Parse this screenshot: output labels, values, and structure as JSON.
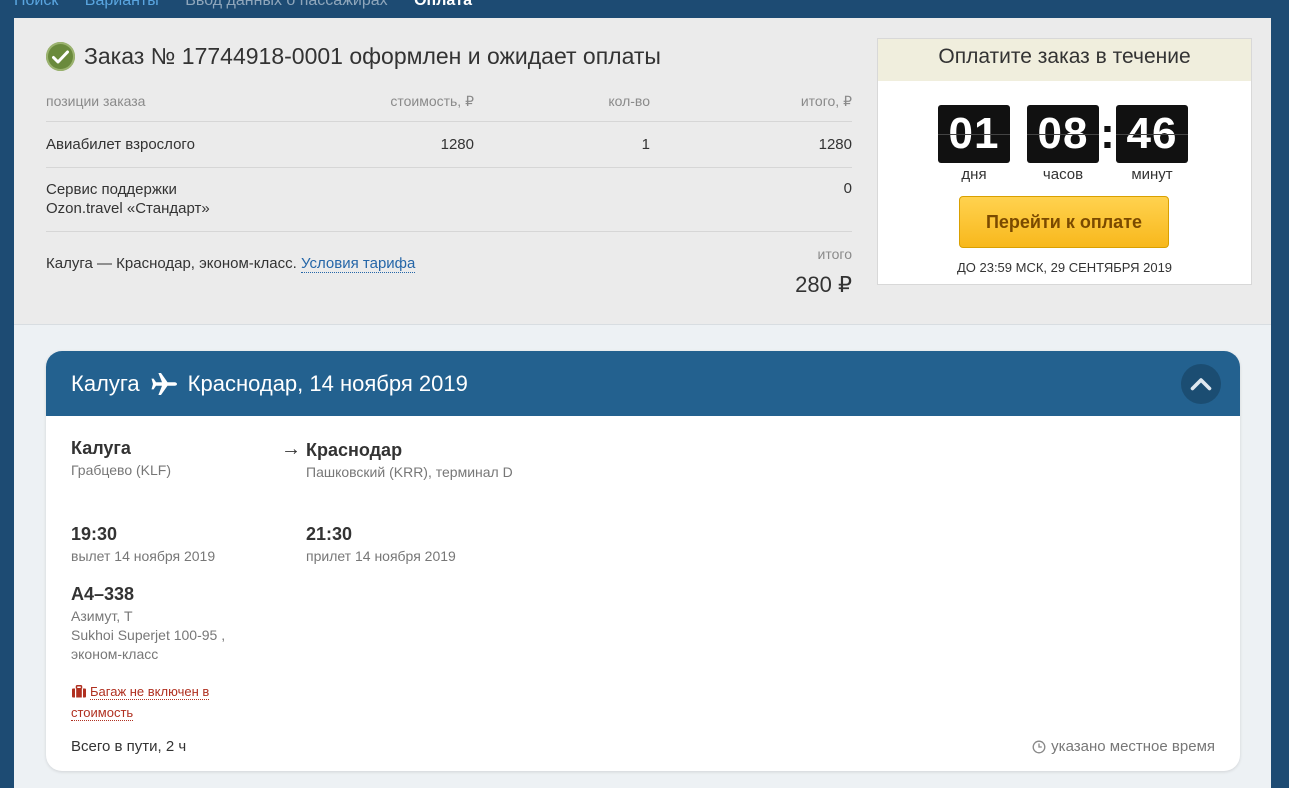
{
  "breadcrumbs": [
    {
      "label": "Поиск"
    },
    {
      "label": "Варианты"
    },
    {
      "label": "Ввод данных о пассажирах"
    },
    {
      "label": "Оплата"
    }
  ],
  "order": {
    "title": "Заказ № 17744918-0001 оформлен и ожидает оплаты",
    "columns": {
      "name": "позиции заказа",
      "price": "стоимость, ₽",
      "qty": "кол-во",
      "total": "итого, ₽"
    },
    "rows": [
      {
        "name": "Авиабилет взрослого",
        "price": "1280",
        "qty": "1",
        "total": "1280"
      },
      {
        "name": "Сервис поддержки Ozon.travel «Стандарт»",
        "price": "",
        "qty": "",
        "total": "0"
      }
    ],
    "route_note": "Калуга — Краснодар, эконом-класс.",
    "tariff_link": "Условия тарифа",
    "total_label": "итого",
    "total_value": "280 ₽"
  },
  "payment": {
    "heading": "Оплатите заказ в течение",
    "timer": [
      {
        "value": "01",
        "label": "дня"
      },
      {
        "value": "08",
        "label": "часов"
      },
      {
        "value": "46",
        "label": "минут"
      }
    ],
    "button": "Перейти к оплате",
    "deadline": "ДО 23:59 МСК, 29 СЕНТЯБРЯ 2019"
  },
  "flight": {
    "header_from": "Калуга",
    "header_to": "Краснодар, 14 ноября 2019",
    "icons": {
      "plane": "plane-icon",
      "collapse": "chevron-up-icon",
      "bag": "luggage-icon",
      "clock": "clock-icon"
    },
    "departure": {
      "city": "Калуга",
      "airport": "Грабцево (KLF)",
      "time": "19:30",
      "date": "вылет 14 ноября 2019"
    },
    "arrow": "→",
    "arrival": {
      "city": "Краснодар",
      "airport": "Пашковский (KRR), терминал D",
      "time": "21:30",
      "date": "прилет 14 ноября 2019"
    },
    "flight_number": "А4–338",
    "carrier": "Азимут, Т",
    "aircraft": "Sukhoi Superjet 100-95 ,",
    "cabin": "эконом-класс",
    "baggage": "Багаж не включен в стоимость",
    "total_time": "Всего в пути, 2 ч",
    "local_time_note": "указано местное время"
  },
  "colors": {
    "header_blue": "#23618f",
    "page_blue": "#1d4b73",
    "pay_button": "#f8b81c",
    "baggage_red": "#b03020"
  }
}
